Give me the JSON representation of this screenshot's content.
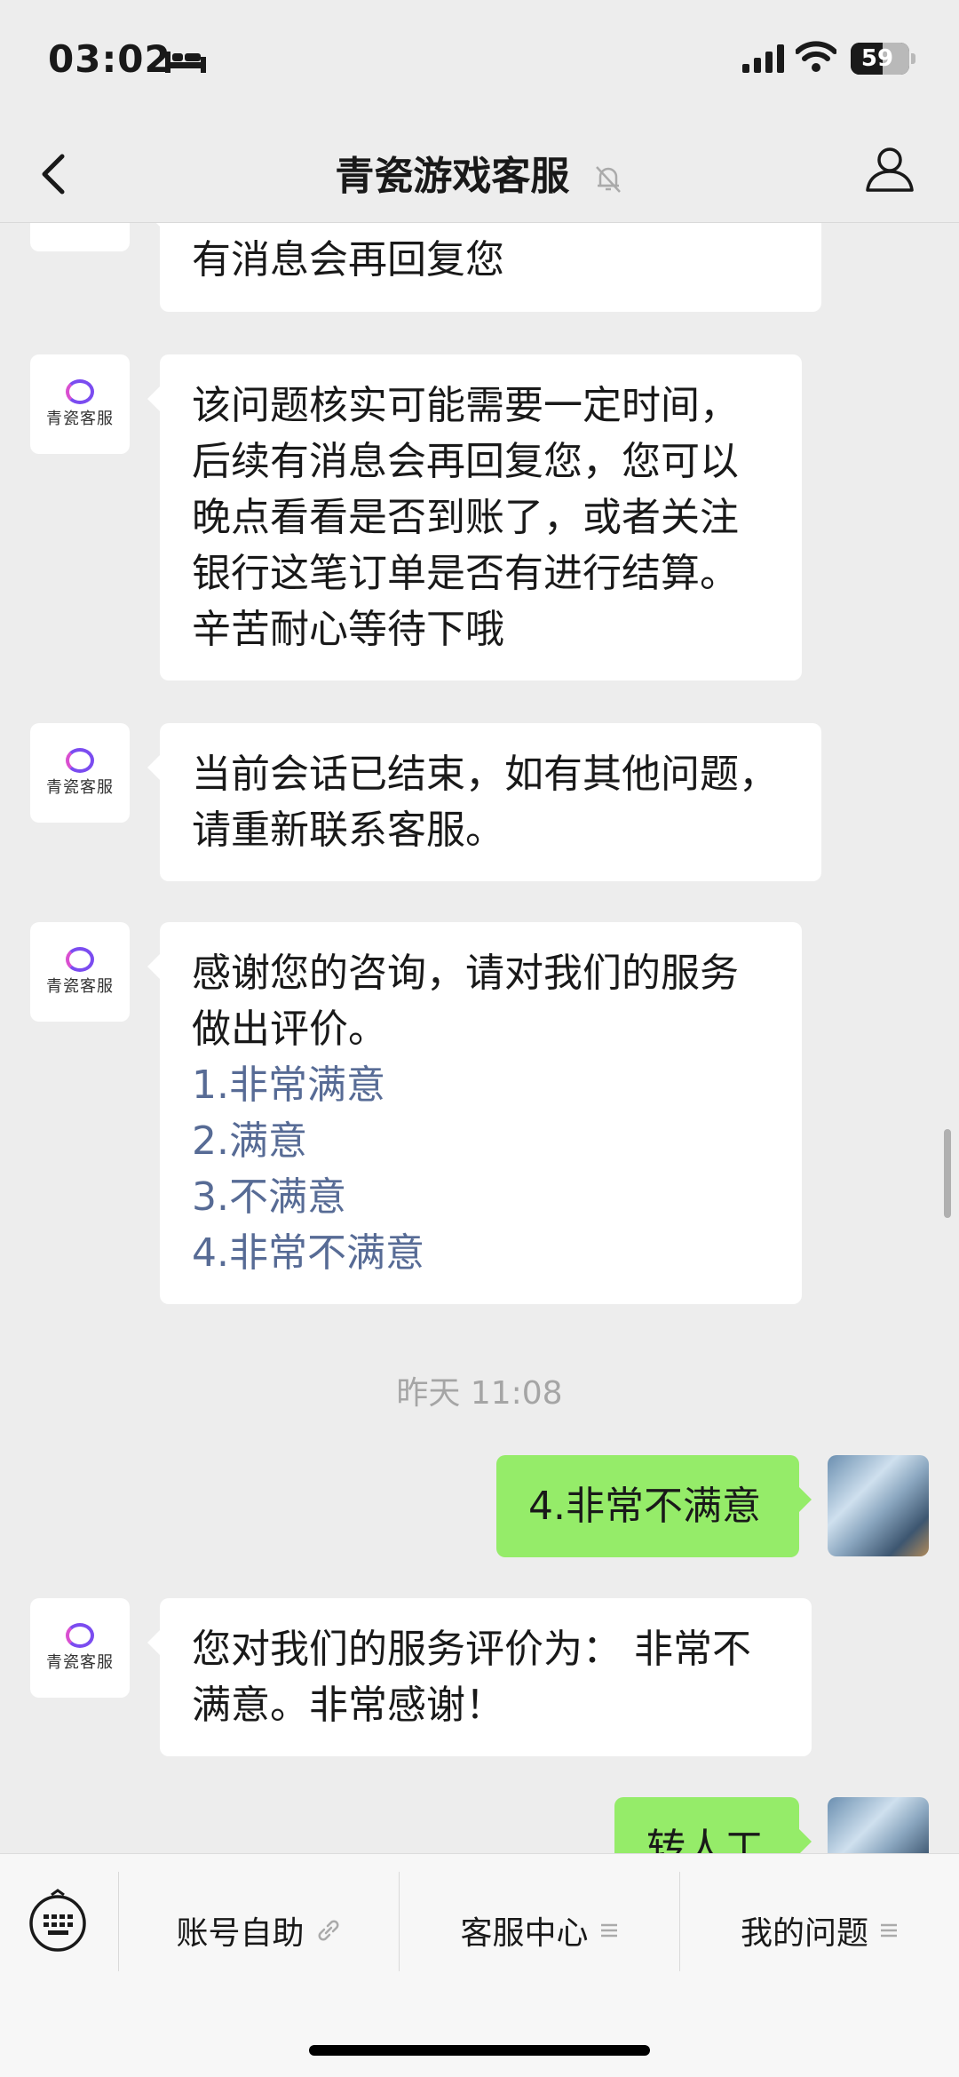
{
  "status_bar": {
    "time": "03:02",
    "battery": "59"
  },
  "nav": {
    "title": "青瓷游戏客服"
  },
  "cs_avatar_label": "青瓷客服",
  "messages": {
    "m0": "有消息会再回复您",
    "m1": [
      "该问题核实可能需要一定时间，",
      "后续有消息会再回复您，您可以",
      "晚点看看是否到账了，或者关注",
      "银行这笔订单是否有进行结算。",
      "辛苦耐心等待下哦"
    ],
    "m2": [
      "当前会话已结束，如有其他问题，",
      "请重新联系客服。"
    ],
    "m3_text": [
      "感谢您的咨询，请对我们的服务",
      "做出评价。"
    ],
    "m3_options": [
      "1.非常满意",
      "2.满意",
      "3.不满意",
      "4.非常不满意"
    ],
    "timestamp": "昨天 11:08",
    "me1": "4.非常不满意",
    "m4": [
      "您对我们的服务评价为： 非常不",
      "满意。非常感谢！"
    ],
    "me2": "转人工"
  },
  "bottom_menu": {
    "items": [
      {
        "label": "账号自助",
        "icon": "link-icon"
      },
      {
        "label": "客服中心",
        "icon": "menu-lines-icon"
      },
      {
        "label": "我的问题",
        "icon": "menu-lines-icon"
      }
    ]
  },
  "colors": {
    "background": "#ededed",
    "my_bubble": "#95ec69",
    "option_link": "#576b95"
  }
}
